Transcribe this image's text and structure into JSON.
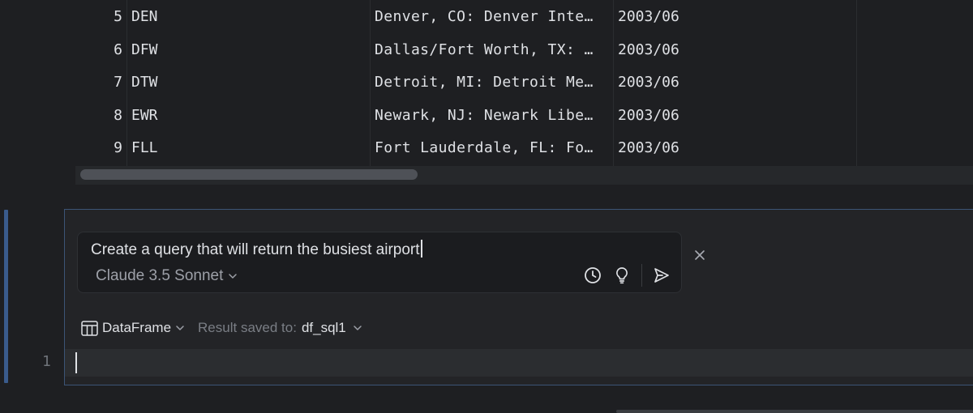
{
  "table": {
    "rows": [
      {
        "index": "5",
        "code": "DEN",
        "name": "Denver, CO: Denver Inte…",
        "date": "2003/06"
      },
      {
        "index": "6",
        "code": "DFW",
        "name": "Dallas/Fort Worth, TX: …",
        "date": "2003/06"
      },
      {
        "index": "7",
        "code": "DTW",
        "name": "Detroit, MI: Detroit Me…",
        "date": "2003/06"
      },
      {
        "index": "8",
        "code": "EWR",
        "name": "Newark, NJ: Newark Libe…",
        "date": "2003/06"
      },
      {
        "index": "9",
        "code": "FLL",
        "name": "Fort Lauderdale, FL: Fo…",
        "date": "2003/06"
      }
    ]
  },
  "ai_prompt": {
    "text": "Create a query that will return the busiest airport",
    "model": "Claude 3.5 Sonnet",
    "icons": [
      "clock-icon",
      "lightbulb-icon",
      "send-icon"
    ]
  },
  "result": {
    "output_type": "DataFrame",
    "saved_label": "Result saved to:",
    "variable": "df_sql1"
  },
  "editor": {
    "line_number": "1"
  },
  "colors": {
    "background": "#1e1f22",
    "cell_border": "#3c5476",
    "cell_marker": "#3a5b8c",
    "text": "#dfe1e5",
    "muted_text": "#7a7e85"
  }
}
